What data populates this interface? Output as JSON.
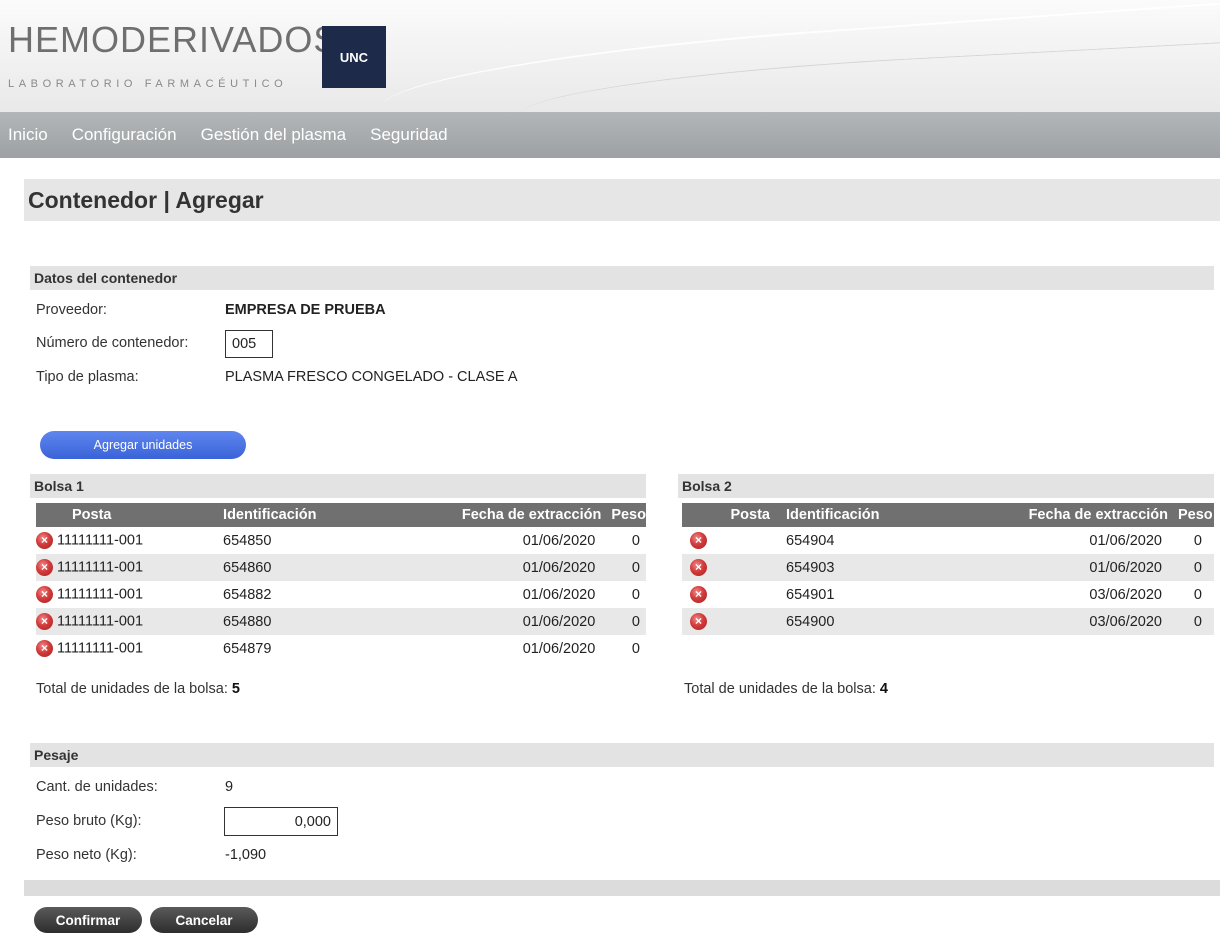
{
  "header": {
    "logo_main": "HEMODERIVADOS",
    "logo_sub": "LABORATORIO FARMACÉUTICO",
    "logo_badge": "UNC"
  },
  "nav": {
    "items": [
      "Inicio",
      "Configuración",
      "Gestión del plasma",
      "Seguridad"
    ]
  },
  "page": {
    "title": "Contenedor | Agregar"
  },
  "container": {
    "section_title": "Datos del contenedor",
    "provider_label": "Proveedor:",
    "provider_value": "EMPRESA DE PRUEBA",
    "number_label": "Número de contenedor:",
    "number_value": "005",
    "plasma_label": "Tipo de plasma:",
    "plasma_value": "PLASMA FRESCO CONGELADO - CLASE A"
  },
  "add_units_button": "Agregar unidades",
  "columns": {
    "posta": "Posta",
    "identificacion": "Identificación",
    "fecha": "Fecha de extracción",
    "peso": "Peso"
  },
  "bag1": {
    "title": "Bolsa 1",
    "rows": [
      {
        "posta": "11111111-001",
        "id": "654850",
        "fecha": "01/06/2020",
        "peso": "0"
      },
      {
        "posta": "11111111-001",
        "id": "654860",
        "fecha": "01/06/2020",
        "peso": "0"
      },
      {
        "posta": "11111111-001",
        "id": "654882",
        "fecha": "01/06/2020",
        "peso": "0"
      },
      {
        "posta": "11111111-001",
        "id": "654880",
        "fecha": "01/06/2020",
        "peso": "0"
      },
      {
        "posta": "11111111-001",
        "id": "654879",
        "fecha": "01/06/2020",
        "peso": "0"
      }
    ],
    "total_label": "Total de unidades de la bolsa:",
    "total_value": "5"
  },
  "bag2": {
    "title": "Bolsa 2",
    "rows": [
      {
        "posta": "",
        "id": "654904",
        "fecha": "01/06/2020",
        "peso": "0"
      },
      {
        "posta": "",
        "id": "654903",
        "fecha": "01/06/2020",
        "peso": "0"
      },
      {
        "posta": "",
        "id": "654901",
        "fecha": "03/06/2020",
        "peso": "0"
      },
      {
        "posta": "",
        "id": "654900",
        "fecha": "03/06/2020",
        "peso": "0"
      }
    ],
    "total_label": "Total de unidades de la bolsa:",
    "total_value": "4"
  },
  "weighing": {
    "section_title": "Pesaje",
    "units_label": "Cant. de unidades:",
    "units_value": "9",
    "gross_label": "Peso bruto (Kg):",
    "gross_value": "0,000",
    "net_label": "Peso neto (Kg):",
    "net_value": "-1,090"
  },
  "actions": {
    "confirm": "Confirmar",
    "cancel": "Cancelar"
  },
  "icons": {
    "delete": "delete-circle-x-icon"
  },
  "colors": {
    "nav_bg": "#a8abae",
    "logo_badge": "#1d2a4a",
    "table_header": "#707070",
    "primary_button": "#4a72e0",
    "delete_icon": "#d23b3b"
  }
}
